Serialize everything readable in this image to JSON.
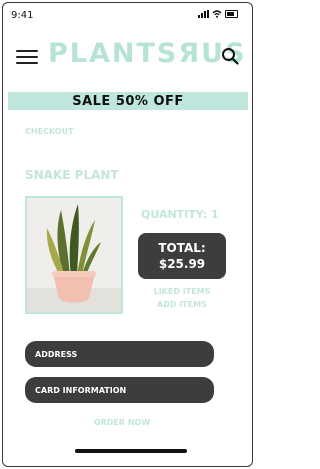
{
  "status_bar": {
    "time": "9:41"
  },
  "header": {
    "logo_text": "PLANTSЯUS",
    "menu_icon": "hamburger-menu-icon",
    "search_icon": "search-icon"
  },
  "banner": {
    "text": "SALE 50% OFF"
  },
  "checkout": {
    "label": "CHECKOUT"
  },
  "product": {
    "title": "SNAKE PLANT",
    "image_icon": "snake-plant-in-pink-pot",
    "quantity_text": "QUANTITY: 1",
    "total_label": "TOTAL:",
    "total_value": "$25.99"
  },
  "links": {
    "liked_items": "LIKED ITEMS",
    "add_items": "ADD ITEMS"
  },
  "form": {
    "address_label": "ADDRESS",
    "card_label": "CARD INFORMATION"
  },
  "cta": {
    "order_now": "ORDER NOW"
  },
  "colors": {
    "accent": "#bfe6dc",
    "dark": "#3d3d3d"
  }
}
